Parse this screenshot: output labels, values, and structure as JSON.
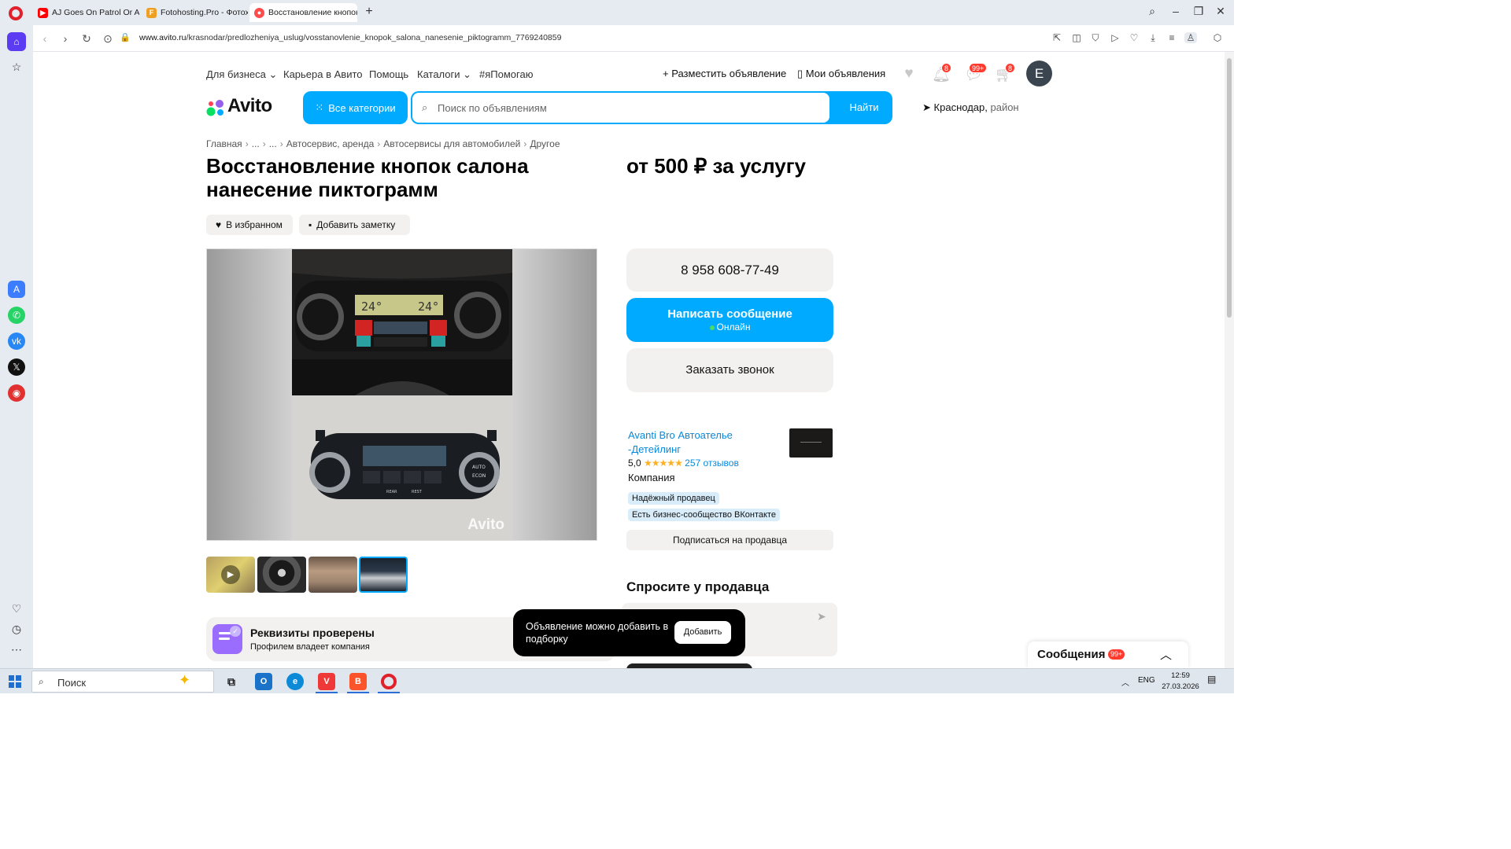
{
  "browser": {
    "tabs": [
      {
        "label": "AJ Goes On Patrol Or AJ S",
        "icon": "youtube-icon",
        "color": "#ff0000",
        "active": false
      },
      {
        "label": "Fotohosting.Pro - Фотохо",
        "icon": "fotohosting-icon",
        "color": "#f0a020",
        "active": false
      },
      {
        "label": "Восстановление кнопок",
        "icon": "avito-icon",
        "color": "#ff4c4c",
        "active": true
      }
    ],
    "url_host": "www.avito.ru",
    "url_path": "/krasnodar/predlozheniya_uslug/vosstanovlenie_knopok_salona_nanesenie_piktogramm_7769240859"
  },
  "header": {
    "links": [
      "Для бизнеса",
      "Карьера в Авито",
      "Помощь",
      "Каталоги",
      "#яПомогаю"
    ],
    "post_ad": "Разместить объявление",
    "my_ads": "Мои объявления",
    "notif_badge": "8",
    "messages_badge": "99+",
    "cart_badge": "8",
    "avatar_letter": "E",
    "logo_text": "Avito",
    "all_categories": "Все категории",
    "search_placeholder": "Поиск по объявлениям",
    "search_button": "Найти",
    "location_city": "Краснодар,",
    "location_region": "район"
  },
  "breadcrumb": [
    "Главная",
    "...",
    "...",
    "Автосервис, аренда",
    "Автосервисы для автомобилей",
    "Другое"
  ],
  "listing": {
    "title": "Восстановление кнопок салона нанесение пиктограмм",
    "price": "от 500 ₽ за услугу",
    "favorite_label": "В избранном",
    "note_label": "Добавить заметку",
    "watermark": "Avito",
    "thumbnails": 4
  },
  "contact": {
    "phone": "8 958 608-77-49",
    "message_button": "Написать сообщение",
    "online_status": "Онлайн",
    "call_button": "Заказать звонок"
  },
  "seller": {
    "name": "Avanti Bro Автоателье -Детейлинг",
    "rating": "5,0",
    "stars": "★★★★★",
    "reviews": "257 отзывов",
    "type": "Компания",
    "tags": [
      "Надёжный продавец",
      "Есть бизнес-сообщество ВКонтакте"
    ],
    "subscribe": "Подписаться на продавца"
  },
  "ask": {
    "title": "Спросите у продавца"
  },
  "verified": {
    "title": "Реквизиты проверены",
    "subtitle": "Профилем владеет компания"
  },
  "toast": {
    "text": "Объявление можно добавить в подборку",
    "button": "Добавить"
  },
  "messages_widget": {
    "title": "Сообщения",
    "badge": "99+"
  },
  "taskbar": {
    "search": "Поиск",
    "lang": "ENG",
    "time": "12:59",
    "date": "27.03.2026"
  }
}
